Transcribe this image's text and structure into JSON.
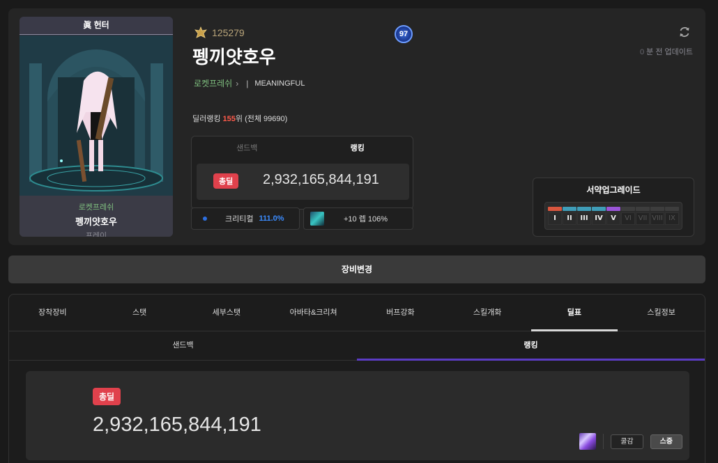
{
  "character": {
    "card_title": "眞 헌터",
    "guild": "로켓프레쉬",
    "name": "펭끼얏호우",
    "server": "프레이",
    "fame": "125279",
    "level": "97",
    "adventure": "MEANINGFUL"
  },
  "update": {
    "num": "0",
    "text": " 분 전 업데이트"
  },
  "ranking": {
    "prefix": "딜러랭킹 ",
    "rank": "155",
    "suffix": "위 (전체 99690)"
  },
  "damage_panel": {
    "tabs": [
      "샌드백",
      "랭킹"
    ],
    "badge": "총딜",
    "value": "2,932,165,844,191"
  },
  "crit": {
    "label": "크리티컬",
    "value": "111.0%"
  },
  "skill": {
    "text": "+10 렙 106%"
  },
  "upgrade": {
    "title": "서약업그레이드",
    "levels": [
      {
        "label": "I",
        "color": "#d9563e",
        "on": true
      },
      {
        "label": "II",
        "color": "#3f9db8",
        "on": true
      },
      {
        "label": "III",
        "color": "#3f9db8",
        "on": true
      },
      {
        "label": "IV",
        "color": "#3f9db8",
        "on": true
      },
      {
        "label": "V",
        "color": "#9a55d8",
        "on": true
      },
      {
        "label": "VI",
        "color": "#3d3d3d",
        "on": false
      },
      {
        "label": "VII",
        "color": "#3d3d3d",
        "on": false
      },
      {
        "label": "VIII",
        "color": "#3d3d3d",
        "on": false
      },
      {
        "label": "IX",
        "color": "#3d3d3d",
        "on": false
      }
    ]
  },
  "equip_change_label": "장비변경",
  "main_tabs": [
    "장착장비",
    "스탯",
    "세부스탯",
    "아바타&크리쳐",
    "버프강화",
    "스킬개화",
    "딜표",
    "스킬정보"
  ],
  "main_tab_active": 6,
  "sub_tabs": [
    "샌드백",
    "랭킹"
  ],
  "sub_tab_active": 1,
  "big_panel": {
    "badge": "총딜",
    "value": "2,932,165,844,191",
    "buttons": [
      "쿨감",
      "스증"
    ]
  },
  "colors": {
    "accent_red": "#e0414c",
    "accent_purple": "#5b3cc4",
    "crit_blue": "#3b8cff",
    "guild_green": "#7fbf7f"
  }
}
